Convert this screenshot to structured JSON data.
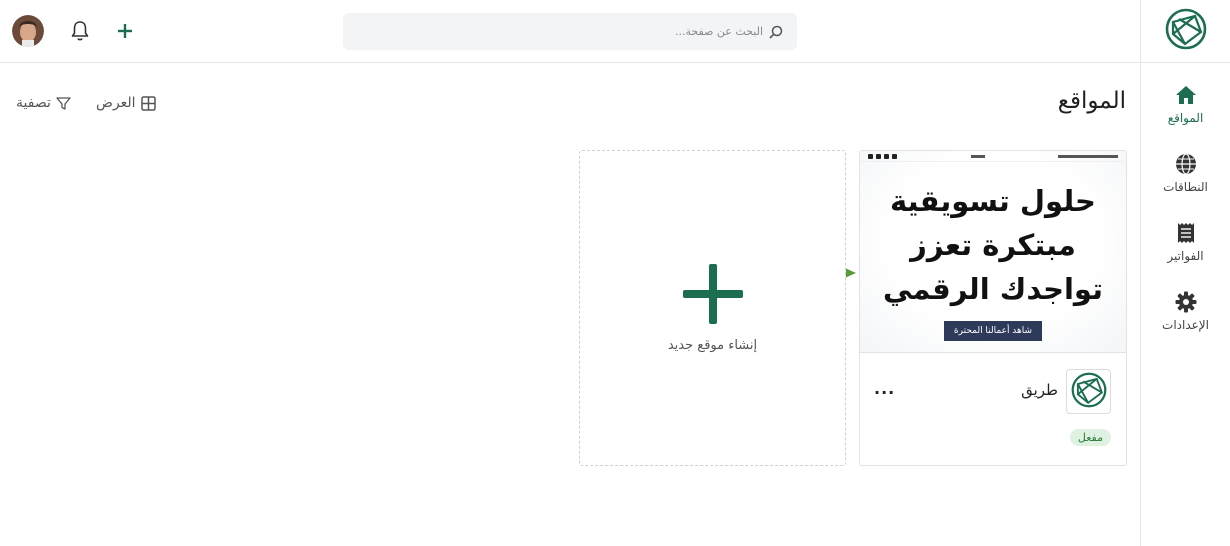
{
  "header": {
    "search_placeholder": "البحث عن صفحة...",
    "icons": {
      "search": "search-icon",
      "bell": "bell-icon",
      "add": "plus-icon",
      "avatar": "user-avatar"
    }
  },
  "sidebar": {
    "items": [
      {
        "label": "المواقع",
        "icon": "home-icon",
        "active": true
      },
      {
        "label": "النطاقات",
        "icon": "globe-icon",
        "active": false
      },
      {
        "label": "الفواتير",
        "icon": "receipt-icon",
        "active": false
      },
      {
        "label": "الإعدادات",
        "icon": "gear-icon",
        "active": false
      }
    ]
  },
  "main": {
    "title": "المواقع",
    "view_label": "العرض",
    "filter_label": "تصفية"
  },
  "site_card": {
    "preview": {
      "headline_line1": "حلول تسويقية",
      "headline_line2": "مبتكرة تعزز",
      "headline_line3": "تواجدك الرقمي",
      "cta": "شاهد أعمالنا المحترة"
    },
    "name": "طريق",
    "more": "...",
    "status": "مفعل"
  },
  "new_site": {
    "label": "إنشاء موقع جديد"
  },
  "colors": {
    "brand": "#1b6e4f",
    "arrow": "#5a9a3c",
    "status_bg": "#dff2e1",
    "status_text": "#2e7d3a",
    "cta_bg": "#2d3a5a"
  }
}
